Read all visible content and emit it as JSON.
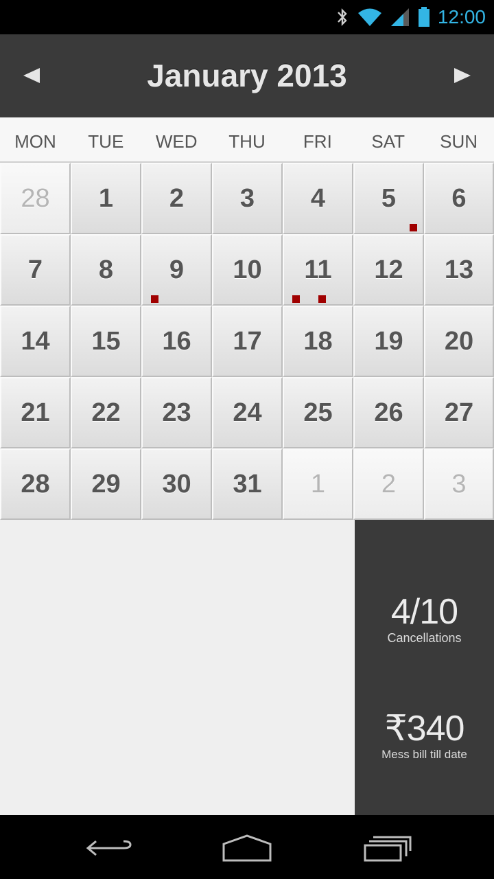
{
  "status_bar": {
    "time": "12:00"
  },
  "header": {
    "month_title": "January 2013",
    "prev_arrow": "◀",
    "next_arrow": "▶"
  },
  "weekdays": [
    "MON",
    "TUE",
    "WED",
    "THU",
    "FRI",
    "SAT",
    "SUN"
  ],
  "weeks": [
    [
      "28",
      "1",
      "2",
      "3",
      "4",
      "5",
      "6"
    ],
    [
      "7",
      "8",
      "9",
      "10",
      "11",
      "12",
      "13"
    ],
    [
      "14",
      "15",
      "16",
      "17",
      "18",
      "19",
      "20"
    ],
    [
      "21",
      "22",
      "23",
      "24",
      "25",
      "26",
      "27"
    ],
    [
      "28",
      "29",
      "30",
      "31",
      "1",
      "2",
      "3"
    ]
  ],
  "muted_days": [
    [
      0,
      0
    ],
    [
      4,
      4
    ],
    [
      4,
      5
    ],
    [
      4,
      6
    ]
  ],
  "event_markers": [
    {
      "week": 0,
      "day": 5,
      "marker": "bottom-right"
    },
    {
      "week": 1,
      "day": 2,
      "marker": "bottom-left"
    },
    {
      "week": 1,
      "day": 4,
      "marker": "bottom-left"
    },
    {
      "week": 1,
      "day": 4,
      "marker": "bottom-center"
    }
  ],
  "summary": {
    "cancellations_value": "4/10",
    "cancellations_label": "Cancellations",
    "bill_value": "₹340",
    "bill_label": "Mess bill till date"
  },
  "colors": {
    "accent_marker": "#a00000",
    "header_bg": "#3a3a3a",
    "status_blue": "#33b5e5"
  }
}
